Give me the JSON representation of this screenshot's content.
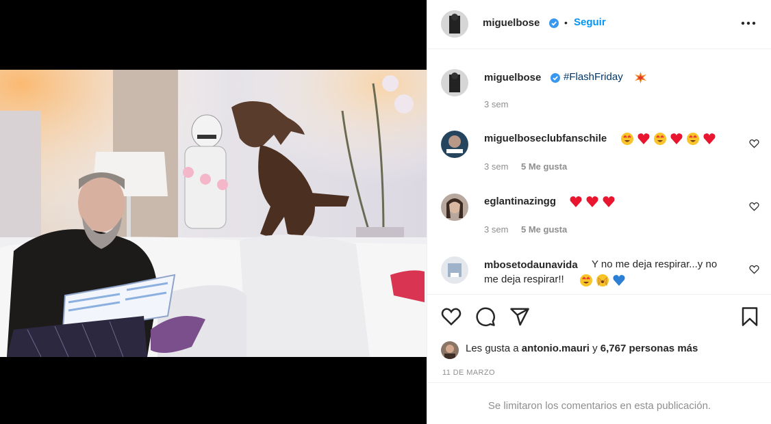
{
  "post": {
    "author": "miguelbose",
    "follow_label": "Seguir",
    "separator": "•",
    "caption_hashtag": "#FlashFriday",
    "caption_time": "3 sem",
    "comments": [
      {
        "user": "miguelboseclubfanschile",
        "time": "3 sem",
        "likes": "5 Me gusta"
      },
      {
        "user": "eglantinazingg",
        "time": "3 sem",
        "likes": "5 Me gusta"
      },
      {
        "user": "mbosetodaunavida",
        "text_line1": "Y no me deja respirar...y no",
        "text_line2": "me deja respirar!!"
      }
    ],
    "likes_prefix": "Les gusta a",
    "likes_user": "antonio.mauri",
    "likes_joiner": "y",
    "likes_count_text": "6,767 personas más",
    "date": "11 DE MARZO",
    "footer_notice": "Se limitaron los comentarios en esta publicación."
  },
  "colors": {
    "accent": "#0095f6",
    "verified": "#3897f0",
    "muted": "#8e8e8e",
    "heart_red": "#ed1c24"
  },
  "icons": [
    "verified-badge-icon",
    "more-options-icon",
    "heart-icon",
    "comment-icon",
    "share-icon",
    "bookmark-icon"
  ]
}
